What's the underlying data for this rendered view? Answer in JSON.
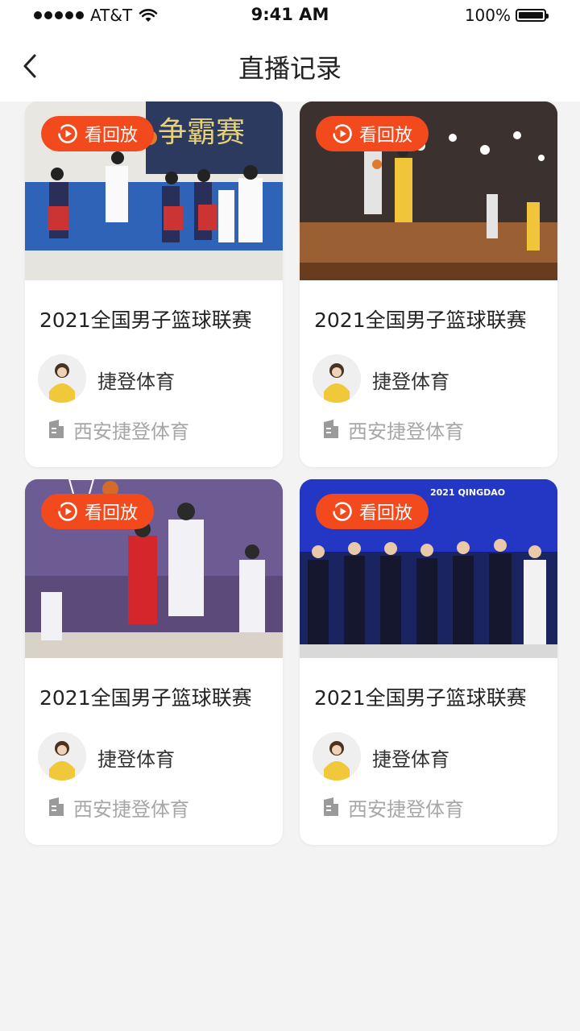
{
  "status_bar": {
    "carrier": "AT&T",
    "time": "9:41 AM",
    "battery": "100%"
  },
  "nav": {
    "title": "直播记录",
    "back_icon": "chevron-left-icon"
  },
  "colors": {
    "accent": "#f24a1d",
    "background": "#f3f3f3"
  },
  "cards": [
    {
      "badge": "看回放",
      "title": "2021全国男子篮球联赛",
      "org": "捷登体育",
      "venue": "西安捷登体育",
      "badge_icon": "replay-icon",
      "venue_icon": "building-icon"
    },
    {
      "badge": "看回放",
      "title": "2021全国男子篮球联赛",
      "org": "捷登体育",
      "venue": "西安捷登体育",
      "badge_icon": "replay-icon",
      "venue_icon": "building-icon"
    },
    {
      "badge": "看回放",
      "title": "2021全国男子篮球联赛",
      "org": "捷登体育",
      "venue": "西安捷登体育",
      "badge_icon": "replay-icon",
      "venue_icon": "building-icon"
    },
    {
      "badge": "看回放",
      "title": "2021全国男子篮球联赛",
      "org": "捷登体育",
      "venue": "西安捷登体育",
      "badge_icon": "replay-icon",
      "venue_icon": "building-icon"
    }
  ]
}
